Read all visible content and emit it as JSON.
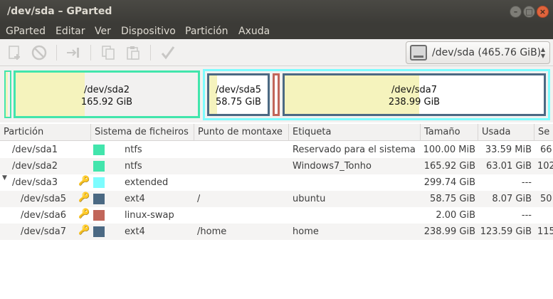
{
  "window": {
    "title": "/dev/sda – GParted"
  },
  "menu": [
    "GParted",
    "Editar",
    "Ver",
    "Dispositivo",
    "Partición",
    "Axuda"
  ],
  "toolbar": {
    "icons": [
      "new-partition-icon",
      "delete-icon",
      "resize-move-icon",
      "copy-icon",
      "paste-icon",
      "apply-icon"
    ]
  },
  "device": {
    "label": "/dev/sda  (465.76 GiB)"
  },
  "map": {
    "sda2": {
      "name": "/dev/sda2",
      "size": "165.92 GiB"
    },
    "sda5": {
      "name": "/dev/sda5",
      "size": "58.75 GiB"
    },
    "sda7": {
      "name": "/dev/sda7",
      "size": "238.99 GiB"
    }
  },
  "table": {
    "headers": [
      "Partición",
      "Sistema de ficheiros",
      "Punto de montaxe",
      "Etiqueta",
      "Tamaño",
      "Usada",
      "Se"
    ],
    "rows": [
      {
        "partition": "/dev/sda1",
        "fs": "ntfs",
        "mount": "",
        "label": "Reservado para el sistema",
        "size": "100.00 MiB",
        "used": "33.59 MiB",
        "extra": "66"
      },
      {
        "partition": "/dev/sda2",
        "fs": "ntfs",
        "mount": "",
        "label": "Windows7_Tonho",
        "size": "165.92 GiB",
        "used": "63.01 GiB",
        "extra": "102"
      },
      {
        "partition": "/dev/sda3",
        "fs": "extended",
        "mount": "",
        "label": "",
        "size": "299.74 GiB",
        "used": "---",
        "extra": ""
      },
      {
        "partition": "/dev/sda5",
        "fs": "ext4",
        "mount": "/",
        "label": "ubuntu",
        "size": "58.75 GiB",
        "used": "8.07 GiB",
        "extra": "50"
      },
      {
        "partition": "/dev/sda6",
        "fs": "linux-swap",
        "mount": "",
        "label": "",
        "size": "2.00 GiB",
        "used": "---",
        "extra": ""
      },
      {
        "partition": "/dev/sda7",
        "fs": "ext4",
        "mount": "/home",
        "label": "home",
        "size": "238.99 GiB",
        "used": "123.59 GiB",
        "extra": "115"
      }
    ]
  },
  "colors": {
    "ntfs": "#42e5ac",
    "extended": "#7dfcfe",
    "ext4": "#4b6983",
    "linux-swap": "#c1665a",
    "used": "#f5f3bd"
  }
}
